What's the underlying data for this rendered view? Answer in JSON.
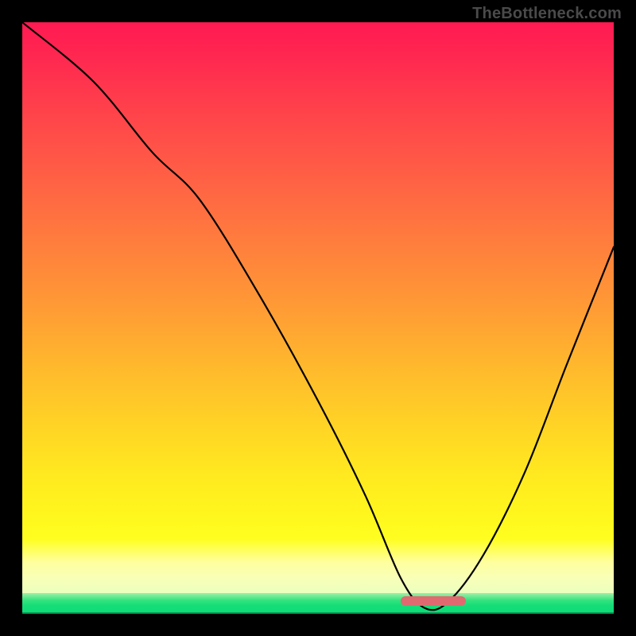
{
  "watermark": "TheBottleneck.com",
  "chart_data": {
    "type": "line",
    "title": "",
    "xlabel": "",
    "ylabel": "",
    "xlim": [
      0,
      100
    ],
    "ylim": [
      0,
      100
    ],
    "grid": false,
    "legend": false,
    "annotations": {
      "optimal_marker": {
        "x_range": [
          64,
          75
        ],
        "color": "#e06a6f"
      }
    },
    "background_bands": [
      {
        "name": "red-yellow-gradient",
        "y_start": 4,
        "y_end": 100
      },
      {
        "name": "pale-yellow",
        "y_start": 3,
        "y_end": 13
      },
      {
        "name": "green",
        "y_start": 0,
        "y_end": 3.5
      }
    ],
    "series": [
      {
        "name": "bottleneck-curve",
        "x": [
          0,
          12,
          22,
          30,
          40,
          50,
          58,
          64,
          68,
          72,
          78,
          85,
          92,
          100
        ],
        "y_percent": [
          100,
          90,
          78,
          70,
          54,
          36,
          20,
          6,
          1,
          2,
          10,
          24,
          42,
          62
        ]
      }
    ]
  }
}
